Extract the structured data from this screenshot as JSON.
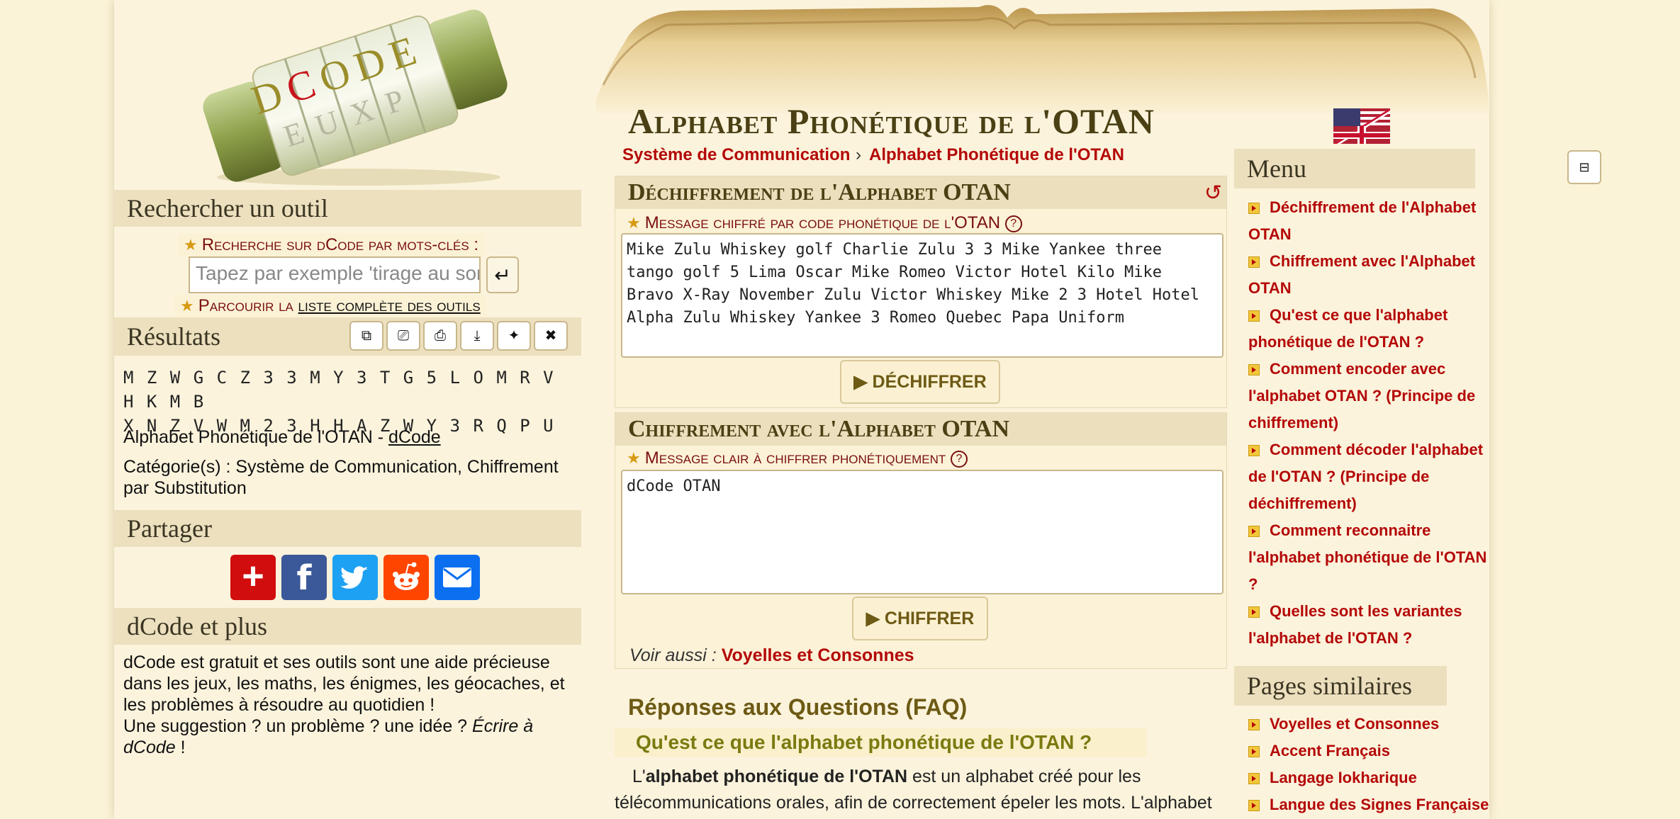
{
  "logo": {
    "letters": "DCODE"
  },
  "search": {
    "title": "Rechercher un outil",
    "keywords_label": "Recherche sur dCode par mots-clés :",
    "placeholder": "Tapez par exemple 'tirage au sort'",
    "browse_prefix": "Parcourir la ",
    "browse_link": "liste complète des outils"
  },
  "results": {
    "title": "Résultats",
    "line1": "M Z W G C Z 3 3 M Y 3 T G 5 L O M R V H K M B",
    "line2": "X N Z V W M 2 3 H H A Z W Y 3 R Q P U",
    "source_text": "Alphabet Phonétique de l'OTAN - ",
    "source_link": "dCode",
    "categories": "Catégorie(s) : Système de Communication, Chiffrement par Substitution"
  },
  "share": {
    "title": "Partager"
  },
  "plus": {
    "title": "dCode et plus",
    "text1": "dCode est gratuit et ses outils sont une aide précieuse dans les jeux, les maths, les énigmes, les géocaches, et les problèmes à résoudre au quotidien !",
    "text2": "Une suggestion ? un problème ? une idée ? ",
    "text2_italic": "Écrire à dCode",
    "text2_end": " !"
  },
  "page": {
    "title": "Alphabet Phonétique de l'OTAN",
    "crumb1": "Système de Communication",
    "crumb_sep": "›",
    "crumb2": "Alphabet Phonétique de l'OTAN"
  },
  "decipher": {
    "title": "Déchiffrement de l'Alphabet OTAN",
    "label": "Message chiffré par code phonétique de l'OTAN",
    "value": "Mike Zulu Whiskey golf Charlie Zulu 3 3 Mike Yankee three tango golf 5 Lima Oscar Mike Romeo Victor Hotel Kilo Mike Bravo X-Ray November Zulu Victor Whiskey Mike 2 3 Hotel Hotel Alpha Zulu Whiskey Yankee 3 Romeo Quebec Papa Uniform",
    "button": "▶ DÉCHIFFRER"
  },
  "encipher": {
    "title": "Chiffrement avec l'Alphabet OTAN",
    "label": "Message clair à chiffrer phonétiquement",
    "value": "dCode OTAN",
    "button": "▶ CHIFFRER",
    "see_also_label": "Voir aussi : ",
    "see_also_link": "Voyelles et Consonnes"
  },
  "faq": {
    "title": "Réponses aux Questions (FAQ)",
    "question": "Qu'est ce que l'alphabet phonétique de l'OTAN ?",
    "body_prefix": "L'",
    "body_bold": "alphabet phonétique de l'OTAN",
    "body_rest": " est un alphabet créé pour les télécommunications orales, afin de correctement épeler les mots. L'alphabet"
  },
  "menu": {
    "title": "Menu",
    "items": [
      "Déchiffrement de l'Alphabet OTAN",
      "Chiffrement avec l'Alphabet OTAN",
      "Qu'est ce que l'alphabet phonétique de l'OTAN ?",
      "Comment encoder avec l'alphabet OTAN ? (Principe de chiffrement)",
      "Comment décoder l'alphabet de l'OTAN ? (Principe de déchiffrement)",
      "Comment reconnaitre l'alphabet phonétique de l'OTAN ?",
      "Quelles sont les variantes l'alphabet de l'OTAN ?"
    ]
  },
  "similar": {
    "title": "Pages similaires",
    "items": [
      "Voyelles et Consonnes",
      "Accent Français",
      "Langage Iokharique",
      "Langue des Signes Française"
    ]
  },
  "colors": {
    "accent_red": "#b40808",
    "olive": "#6d5a14",
    "panel": "#ecdfbd"
  }
}
